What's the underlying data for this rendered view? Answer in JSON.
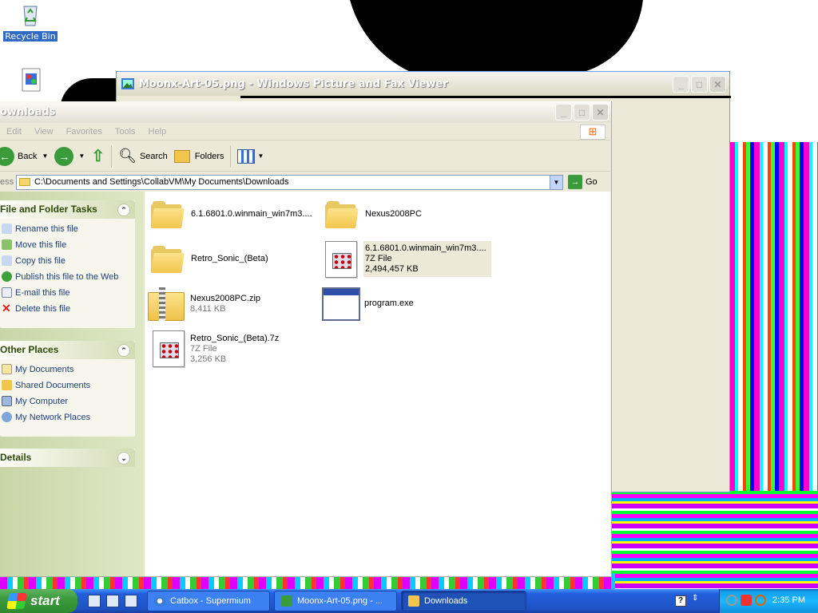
{
  "desktop": {
    "icons": [
      {
        "label": "Recycle Bin",
        "icon": "recycle-bin-icon"
      }
    ]
  },
  "picture_viewer": {
    "title": "Moonx-Art-05.png - Windows Picture and Fax Viewer"
  },
  "explorer": {
    "title": "ownloads",
    "menu": [
      "Edit",
      "View",
      "Favorites",
      "Tools",
      "Help"
    ],
    "toolbar": {
      "back": "Back",
      "search": "Search",
      "folders": "Folders"
    },
    "address": {
      "label": "ess",
      "value": "C:\\Documents and Settings\\CollabVM\\My Documents\\Downloads",
      "go": "Go"
    },
    "tasks": {
      "title": "File and Folder Tasks",
      "items": [
        "Rename this file",
        "Move this file",
        "Copy this file",
        "Publish this file to the Web",
        "E-mail this file",
        "Delete this file"
      ]
    },
    "other_places": {
      "title": "Other Places",
      "items": [
        "My Documents",
        "Shared Documents",
        "My Computer",
        "My Network Places"
      ]
    },
    "details": {
      "title": "Details"
    },
    "files": [
      {
        "name": "6.1.6801.0.winmain_win7m3....",
        "type": "",
        "size": "",
        "icon": "folder-icon"
      },
      {
        "name": "Nexus2008PC",
        "type": "",
        "size": "",
        "icon": "folder-icon"
      },
      {
        "name": "Retro_Sonic_(Beta)",
        "type": "",
        "size": "",
        "icon": "folder-icon"
      },
      {
        "name": "6.1.6801.0.winmain_win7m3....",
        "type": "7Z File",
        "size": "2,494,457 KB",
        "icon": "7z-file-icon"
      },
      {
        "name": "Nexus2008PC.zip",
        "type": "",
        "size": "8,411 KB",
        "icon": "zip-folder-icon"
      },
      {
        "name": "program.exe",
        "type": "",
        "size": "",
        "icon": "exe-icon"
      },
      {
        "name": "Retro_Sonic_(Beta).7z",
        "type": "7Z File",
        "size": "3,256 KB",
        "icon": "7z-file-icon"
      }
    ]
  },
  "taskbar": {
    "start": "start",
    "tasks": [
      {
        "label": "Catbox - Supermium",
        "icon": "supermium-icon"
      },
      {
        "label": "Moonx-Art-05.png - ...",
        "icon": "picture-viewer-icon"
      },
      {
        "label": "Downloads",
        "icon": "folder-icon"
      }
    ],
    "help": "?",
    "clock": "2:35 PM"
  },
  "colors": {
    "taskbar_blue": "#245edb",
    "start_green": "#3c9a3c",
    "link_blue": "#1f3f7a"
  }
}
